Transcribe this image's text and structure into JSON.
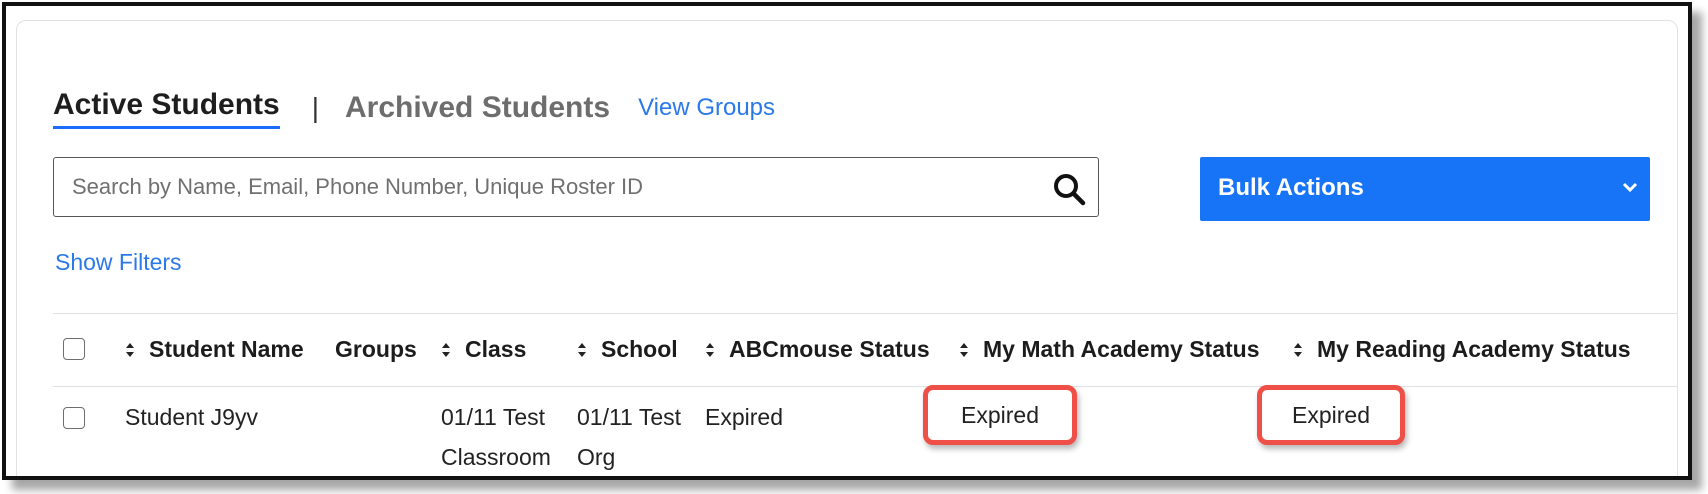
{
  "tabs": {
    "active": "Active Students",
    "separator": "|",
    "archived": "Archived Students",
    "view_groups": "View Groups"
  },
  "search": {
    "placeholder": "Search by Name, Email, Phone Number, Unique Roster ID",
    "value": ""
  },
  "bulk_actions": {
    "label": "Bulk Actions"
  },
  "filters": {
    "label": "Show Filters"
  },
  "table": {
    "columns": [
      "Student Name",
      "Groups",
      "Class",
      "School",
      "ABCmouse Status",
      "My Math Academy Status",
      "My Reading Academy Status"
    ],
    "rows": [
      {
        "student_name": "Student J9yv",
        "groups": "",
        "class_line1": "01/11 Test",
        "class_line2": "Classroom",
        "school_line1": "01/11 Test",
        "school_line2": "Org",
        "abcmouse_status": "Expired",
        "math_status": "Expired",
        "reading_status": "Expired"
      }
    ]
  },
  "colors": {
    "accent": "#1874f6",
    "link": "#2b79e8",
    "highlight": "#ee5048"
  }
}
